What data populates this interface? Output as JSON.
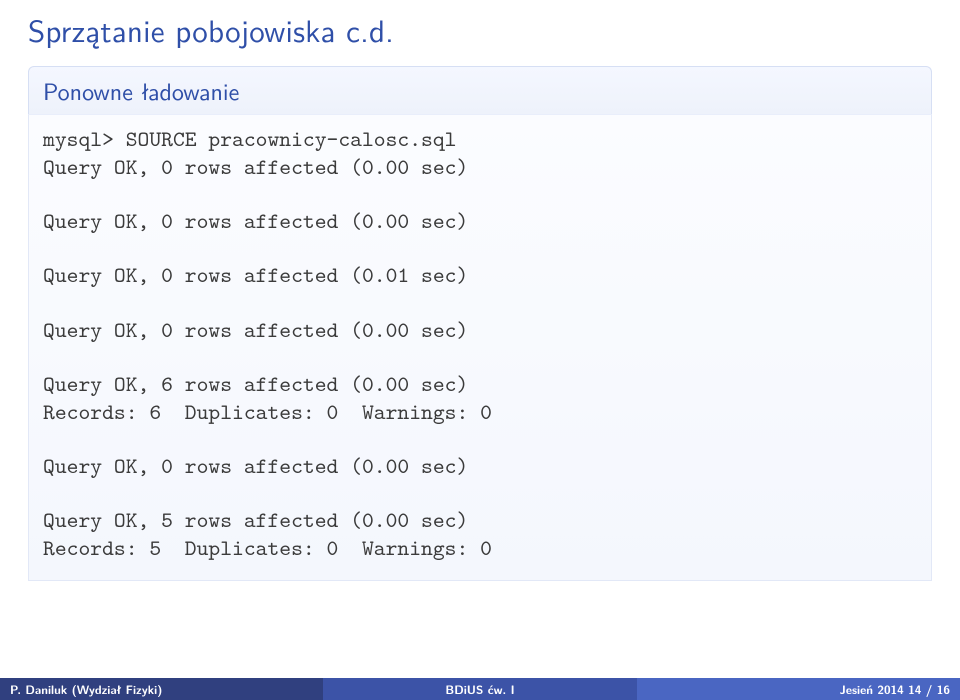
{
  "title": "Sprzątanie pobojowiska c.d.",
  "block": {
    "header": "Ponowne ładowanie",
    "lines": {
      "l1": "mysql> SOURCE pracownicy-calosc.sql",
      "l2": "Query OK, 0 rows affected (0.00 sec)",
      "l3": "Query OK, 0 rows affected (0.00 sec)",
      "l4": "Query OK, 0 rows affected (0.01 sec)",
      "l5": "Query OK, 0 rows affected (0.00 sec)",
      "l6": "Query OK, 6 rows affected (0.00 sec)",
      "l7": "Records: 6  Duplicates: 0  Warnings: 0",
      "l8": "Query OK, 0 rows affected (0.00 sec)",
      "l9": "Query OK, 5 rows affected (0.00 sec)",
      "l10": "Records: 5  Duplicates: 0  Warnings: 0"
    }
  },
  "footer": {
    "left": "P. Daniluk (Wydział Fizyki)",
    "mid": "BDiUS ćw. I",
    "right": "Jesień 2014      14 / 16"
  }
}
